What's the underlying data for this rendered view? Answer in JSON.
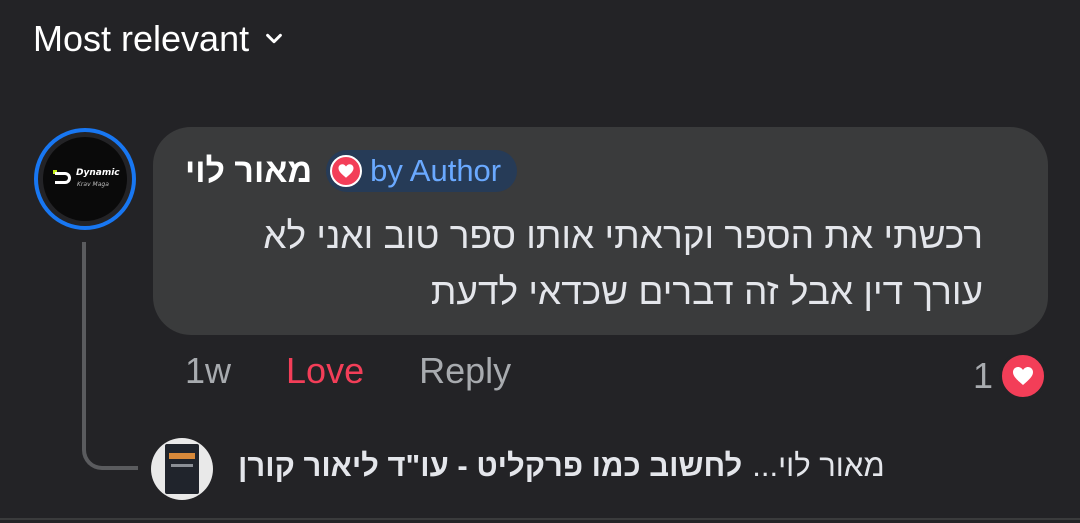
{
  "sort": {
    "label": "Most relevant",
    "icon": "chevron-down-icon"
  },
  "comment": {
    "avatar": {
      "icon": "dynamic-krav-maga-logo",
      "logo_text_main": "Dynamic",
      "logo_text_sub": "Krav Maga",
      "ring_color": "#1877f2"
    },
    "author": "מאור לוי",
    "author_badge": {
      "icon": "heart-icon",
      "label": "by Author"
    },
    "text": "רכשתי את הספר וקראתי אותו ספר טוב ואני לא\nעורך דין אבל זה  דברים שכדאי לדעת",
    "actions": {
      "time": "1w",
      "love": "Love",
      "reply": "Reply"
    },
    "reactions": {
      "count": "1",
      "icon": "heart-reaction-icon"
    }
  },
  "reply_preview": {
    "thumbnail_icon": "book-cover-thumbnail",
    "author": "מאור לוי...",
    "text": "לחשוב כמו פרקליט - עו\"ד ליאור קורן"
  },
  "colors": {
    "background": "#232326",
    "bubble": "#3a3b3c",
    "love": "#f33e58",
    "badge_text": "#6aa9ff",
    "badge_bg": "#263b57"
  }
}
